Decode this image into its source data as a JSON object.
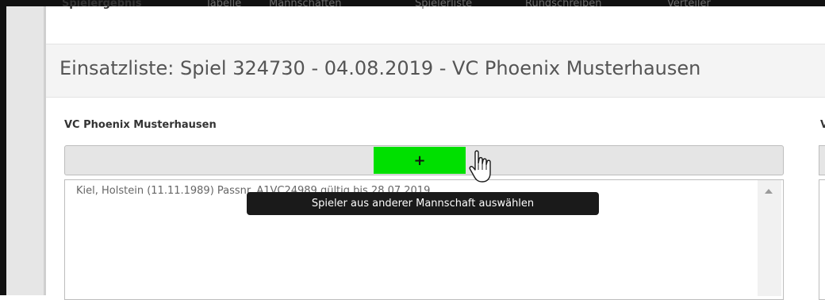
{
  "tabs": [
    {
      "label": "Spielergebnis",
      "active": true
    },
    {
      "label": "Tabelle",
      "active": false
    },
    {
      "label": "Mannschaften",
      "active": false
    },
    {
      "label": "Spielerliste",
      "active": false
    },
    {
      "label": "Rundschreiben",
      "active": false
    },
    {
      "label": "Verteiler",
      "active": false
    }
  ],
  "page": {
    "title": "Einsatzliste: Spiel 324730 - 04.08.2019 - VC Phoenix Musterhausen"
  },
  "team_left": {
    "name": "VC Phoenix Musterhausen",
    "add_button_label": "+",
    "players": [
      "Kiel, Holstein (11.11.1989) Passnr. A1VC24989 gültig bis 28.07.2019"
    ]
  },
  "team_right": {
    "name_fragment": "V"
  },
  "tooltip": {
    "text": "Spieler aus anderer Mannschaft auswählen"
  },
  "colors": {
    "add_button": "#00e000",
    "tooltip_bg": "#1a1a1a"
  }
}
